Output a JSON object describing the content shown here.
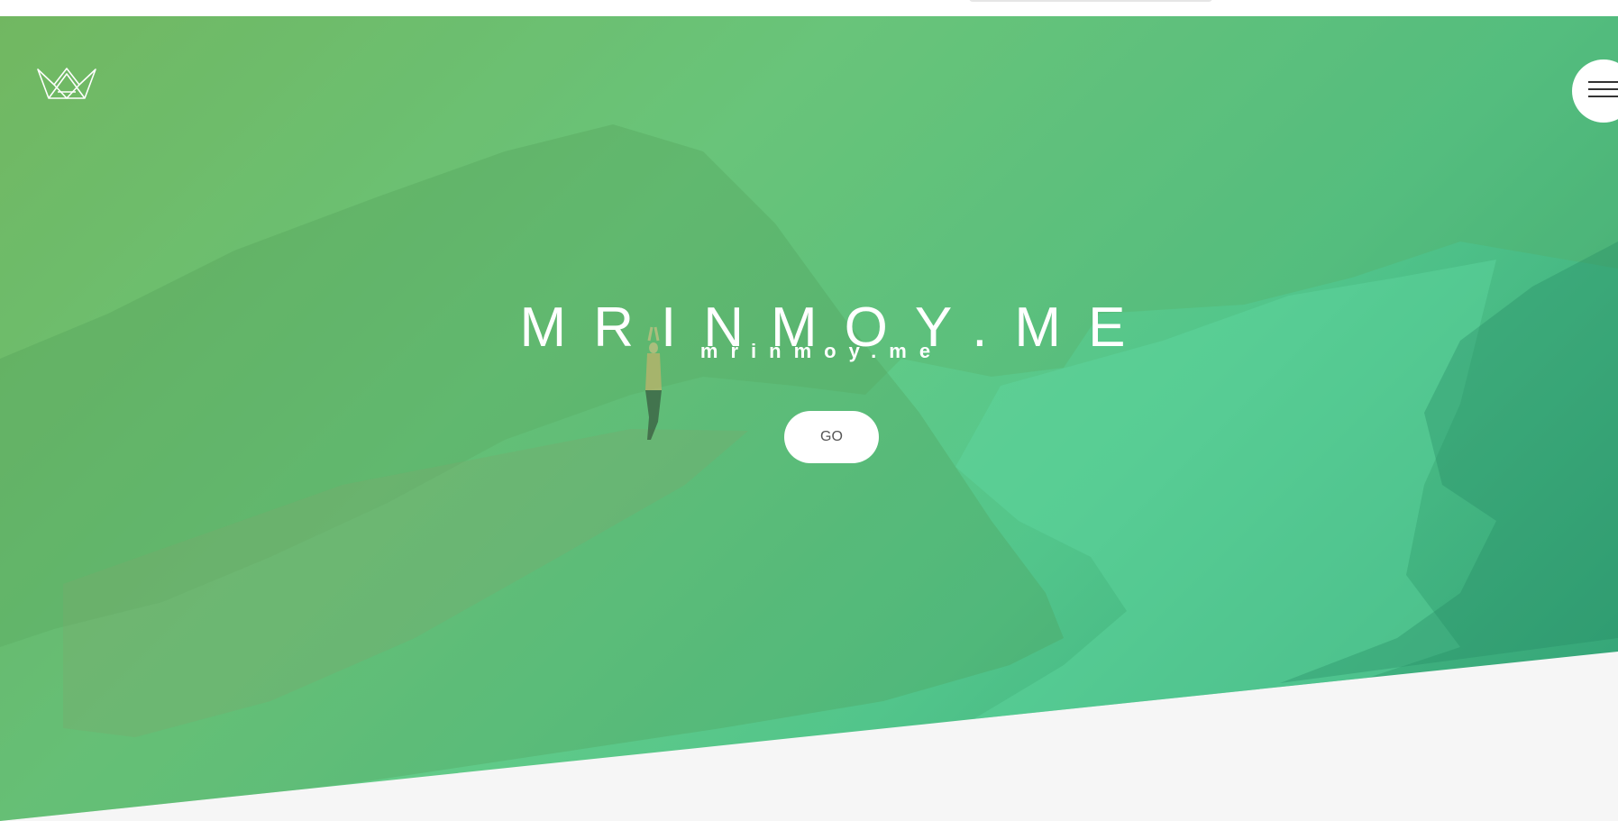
{
  "header": {
    "logo_icon": "crown-icon",
    "menu_icon": "hamburger-menu-icon"
  },
  "hero": {
    "title": "MRINMOY.ME",
    "subtitle": "mrinmoy.me",
    "go_button_label": "GO"
  },
  "colors": {
    "hero_gradient_start": "#7bbd63",
    "hero_gradient_mid": "#6fcf85",
    "hero_gradient_end": "#2f9f74",
    "text": "#ffffff",
    "button_background": "#ffffff",
    "button_text": "#555555",
    "page_background": "#f6f6f6"
  }
}
